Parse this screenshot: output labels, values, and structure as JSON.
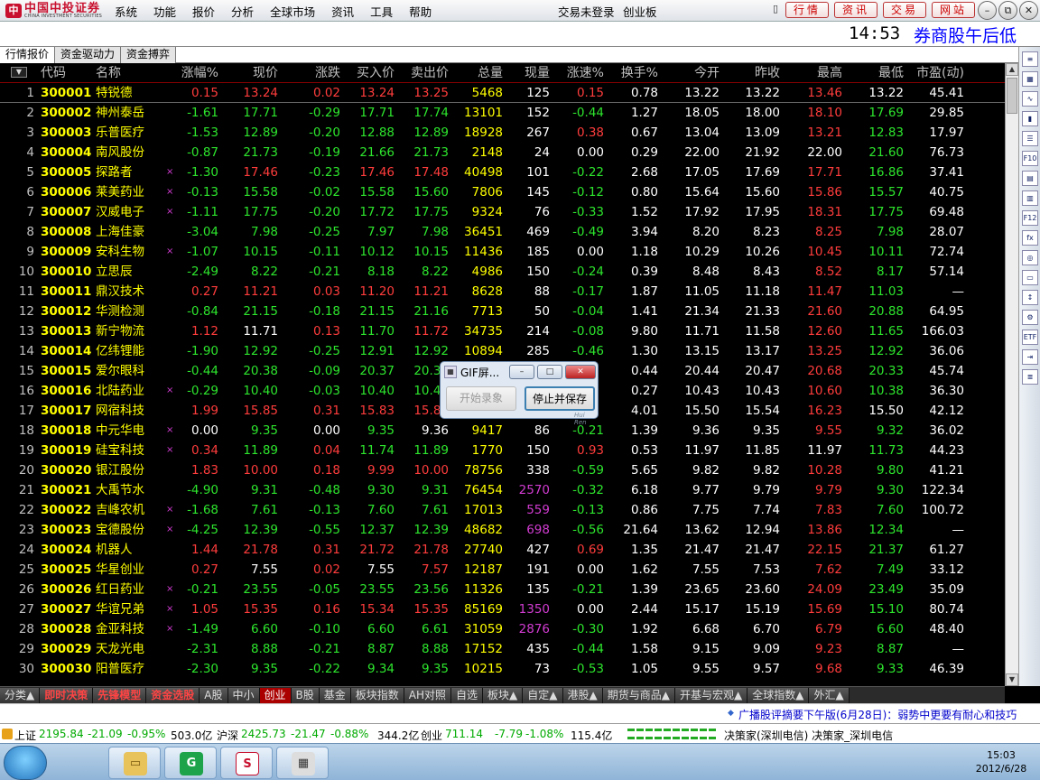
{
  "menubar": {
    "brand_cn": "中国中投证券",
    "brand_en": "CHINA INVESTMENT SECURITIES",
    "menus": [
      "系统",
      "功能",
      "报价",
      "分析",
      "全球市场",
      "资讯",
      "工具",
      "帮助"
    ],
    "trade_status": "交易未登录",
    "board": "创业板",
    "buttons": [
      "行情",
      "资讯",
      "交易",
      "网站"
    ]
  },
  "status": {
    "time": "14:53",
    "session": "券商股午后低"
  },
  "tabs": [
    "行情报价",
    "资金驱动力",
    "资金搏弈"
  ],
  "columns": [
    "代码",
    "名称",
    "涨幅%",
    "现价",
    "涨跌",
    "买入价",
    "卖出价",
    "总量",
    "现量",
    "涨速%",
    "换手%",
    "今开",
    "昨收",
    "最高",
    "最低",
    "市盈(动)"
  ],
  "rows": [
    [
      "1",
      "300001",
      "特锐德",
      "",
      "0.15",
      "13.24",
      "0.02",
      "13.24",
      "13.25",
      "5468",
      "125",
      "0.15",
      "0.78",
      "13.22",
      "13.22",
      "13.46",
      "13.22",
      "45.41"
    ],
    [
      "2",
      "300002",
      "神州泰岳",
      "",
      "-1.61",
      "17.71",
      "-0.29",
      "17.71",
      "17.74",
      "13101",
      "152",
      "-0.44",
      "1.27",
      "18.05",
      "18.00",
      "18.10",
      "17.69",
      "29.85"
    ],
    [
      "3",
      "300003",
      "乐普医疗",
      "",
      "-1.53",
      "12.89",
      "-0.20",
      "12.88",
      "12.89",
      "18928",
      "267",
      "0.38",
      "0.67",
      "13.04",
      "13.09",
      "13.21",
      "12.83",
      "17.97"
    ],
    [
      "4",
      "300004",
      "南风股份",
      "",
      "-0.87",
      "21.73",
      "-0.19",
      "21.66",
      "21.73",
      "2148",
      "24",
      "0.00",
      "0.29",
      "22.00",
      "21.92",
      "22.00",
      "21.60",
      "76.73"
    ],
    [
      "5",
      "300005",
      "探路者",
      "×",
      "-1.30",
      "17.46",
      "-0.23",
      "17.46",
      "17.48",
      "40498",
      "101",
      "-0.22",
      "2.68",
      "17.05",
      "17.69",
      "17.71",
      "16.86",
      "37.41"
    ],
    [
      "6",
      "300006",
      "莱美药业",
      "×",
      "-0.13",
      "15.58",
      "-0.02",
      "15.58",
      "15.60",
      "7806",
      "145",
      "-0.12",
      "0.80",
      "15.64",
      "15.60",
      "15.86",
      "15.57",
      "40.75"
    ],
    [
      "7",
      "300007",
      "汉威电子",
      "×",
      "-1.11",
      "17.75",
      "-0.20",
      "17.72",
      "17.75",
      "9324",
      "76",
      "-0.33",
      "1.52",
      "17.92",
      "17.95",
      "18.31",
      "17.75",
      "69.48"
    ],
    [
      "8",
      "300008",
      "上海佳豪",
      "",
      "-3.04",
      "7.98",
      "-0.25",
      "7.97",
      "7.98",
      "36451",
      "469",
      "-0.49",
      "3.94",
      "8.20",
      "8.23",
      "8.25",
      "7.98",
      "28.07"
    ],
    [
      "9",
      "300009",
      "安科生物",
      "×",
      "-1.07",
      "10.15",
      "-0.11",
      "10.12",
      "10.15",
      "11436",
      "185",
      "0.00",
      "1.18",
      "10.29",
      "10.26",
      "10.45",
      "10.11",
      "72.74"
    ],
    [
      "10",
      "300010",
      "立思辰",
      "",
      "-2.49",
      "8.22",
      "-0.21",
      "8.18",
      "8.22",
      "4986",
      "150",
      "-0.24",
      "0.39",
      "8.48",
      "8.43",
      "8.52",
      "8.17",
      "57.14"
    ],
    [
      "11",
      "300011",
      "鼎汉技术",
      "",
      "0.27",
      "11.21",
      "0.03",
      "11.20",
      "11.21",
      "8628",
      "88",
      "-0.17",
      "1.87",
      "11.05",
      "11.18",
      "11.47",
      "11.03",
      "—"
    ],
    [
      "12",
      "300012",
      "华测检测",
      "",
      "-0.84",
      "21.15",
      "-0.18",
      "21.15",
      "21.16",
      "7713",
      "50",
      "-0.04",
      "1.41",
      "21.34",
      "21.33",
      "21.60",
      "20.88",
      "64.95"
    ],
    [
      "13",
      "300013",
      "新宁物流",
      "",
      "1.12",
      "11.71",
      "0.13",
      "11.70",
      "11.72",
      "34735",
      "214",
      "-0.08",
      "9.80",
      "11.71",
      "11.58",
      "12.60",
      "11.65",
      "166.03"
    ],
    [
      "14",
      "300014",
      "亿纬锂能",
      "",
      "-1.90",
      "12.92",
      "-0.25",
      "12.91",
      "12.92",
      "10894",
      "285",
      "-0.46",
      "1.30",
      "13.15",
      "13.17",
      "13.25",
      "12.92",
      "36.06"
    ],
    [
      "15",
      "300015",
      "爱尔眼科",
      "",
      "-0.44",
      "20.38",
      "-0.09",
      "20.37",
      "20.38",
      "",
      "",
      "",
      "0.44",
      "20.44",
      "20.47",
      "20.68",
      "20.33",
      "45.74"
    ],
    [
      "16",
      "300016",
      "北陆药业",
      "×",
      "-0.29",
      "10.40",
      "-0.03",
      "10.40",
      "10.41",
      "",
      "",
      "",
      "0.27",
      "10.43",
      "10.43",
      "10.60",
      "10.38",
      "36.30"
    ],
    [
      "17",
      "300017",
      "网宿科技",
      "",
      "1.99",
      "15.85",
      "0.31",
      "15.83",
      "15.85",
      "",
      "",
      "",
      "4.01",
      "15.50",
      "15.54",
      "16.23",
      "15.50",
      "42.12"
    ],
    [
      "18",
      "300018",
      "中元华电",
      "×",
      "0.00",
      "9.35",
      "0.00",
      "9.35",
      "9.36",
      "9417",
      "86",
      "-0.21",
      "1.39",
      "9.36",
      "9.35",
      "9.55",
      "9.32",
      "36.02"
    ],
    [
      "19",
      "300019",
      "硅宝科技",
      "×",
      "0.34",
      "11.89",
      "0.04",
      "11.74",
      "11.89",
      "1770",
      "150",
      "0.93",
      "0.53",
      "11.97",
      "11.85",
      "11.97",
      "11.73",
      "44.23"
    ],
    [
      "20",
      "300020",
      "银江股份",
      "",
      "1.83",
      "10.00",
      "0.18",
      "9.99",
      "10.00",
      "78756",
      "338",
      "-0.59",
      "5.65",
      "9.82",
      "9.82",
      "10.28",
      "9.80",
      "41.21"
    ],
    [
      "21",
      "300021",
      "大禹节水",
      "",
      "-4.90",
      "9.31",
      "-0.48",
      "9.30",
      "9.31",
      "76454",
      "2570",
      "-0.32",
      "6.18",
      "9.77",
      "9.79",
      "9.79",
      "9.30",
      "122.34"
    ],
    [
      "22",
      "300022",
      "吉峰农机",
      "×",
      "-1.68",
      "7.61",
      "-0.13",
      "7.60",
      "7.61",
      "17013",
      "559",
      "-0.13",
      "0.86",
      "7.75",
      "7.74",
      "7.83",
      "7.60",
      "100.72"
    ],
    [
      "23",
      "300023",
      "宝德股份",
      "×",
      "-4.25",
      "12.39",
      "-0.55",
      "12.37",
      "12.39",
      "48682",
      "698",
      "-0.56",
      "21.64",
      "13.62",
      "12.94",
      "13.86",
      "12.34",
      "—"
    ],
    [
      "24",
      "300024",
      "机器人",
      "",
      "1.44",
      "21.78",
      "0.31",
      "21.72",
      "21.78",
      "27740",
      "427",
      "0.69",
      "1.35",
      "21.47",
      "21.47",
      "22.15",
      "21.37",
      "61.27"
    ],
    [
      "25",
      "300025",
      "华星创业",
      "",
      "0.27",
      "7.55",
      "0.02",
      "7.55",
      "7.57",
      "12187",
      "191",
      "0.00",
      "1.62",
      "7.55",
      "7.53",
      "7.62",
      "7.49",
      "33.12"
    ],
    [
      "26",
      "300026",
      "红日药业",
      "×",
      "-0.21",
      "23.55",
      "-0.05",
      "23.55",
      "23.56",
      "11326",
      "135",
      "-0.21",
      "1.39",
      "23.65",
      "23.60",
      "24.09",
      "23.49",
      "35.09"
    ],
    [
      "27",
      "300027",
      "华谊兄弟",
      "×",
      "1.05",
      "15.35",
      "0.16",
      "15.34",
      "15.35",
      "85169",
      "1350",
      "0.00",
      "2.44",
      "15.17",
      "15.19",
      "15.69",
      "15.10",
      "80.74"
    ],
    [
      "28",
      "300028",
      "金亚科技",
      "×",
      "-1.49",
      "6.60",
      "-0.10",
      "6.60",
      "6.61",
      "31059",
      "2876",
      "-0.30",
      "1.92",
      "6.68",
      "6.70",
      "6.79",
      "6.60",
      "48.40"
    ],
    [
      "29",
      "300029",
      "天龙光电",
      "",
      "-2.31",
      "8.88",
      "-0.21",
      "8.87",
      "8.88",
      "17152",
      "435",
      "-0.44",
      "1.58",
      "9.15",
      "9.09",
      "9.23",
      "8.87",
      "—"
    ],
    [
      "30",
      "300030",
      "阳普医疗",
      "",
      "-2.30",
      "9.35",
      "-0.22",
      "9.34",
      "9.35",
      "10215",
      "73",
      "-0.53",
      "1.05",
      "9.55",
      "9.57",
      "9.68",
      "9.33",
      "46.39"
    ]
  ],
  "categories": [
    "分类▲",
    "即时决策",
    "先锋模型",
    "资金选股",
    "A股",
    "中小",
    "创业",
    "B股",
    "基金",
    "板块指数",
    "AH对照",
    "自选",
    "板块▲",
    "自定▲",
    "港股▲",
    "期货与商品▲",
    "开基与宏观▲",
    "全球指数▲",
    "外汇▲"
  ],
  "news": "广播股评摘要下午版(6月28日)：弱势中更要有耐心和技巧",
  "indices": {
    "sh_name": "上证",
    "sh_val": "2195.84",
    "sh_chg": "-21.09",
    "sh_pct": "-0.95%",
    "sh_amt": "503.0亿",
    "sz_name": "沪深",
    "sz_val": "2425.73",
    "sz_chg": "-21.47",
    "sz_pct": "-0.88%",
    "sz_amt": "344.2亿",
    "cy_name": "创业",
    "cy_val": "711.14",
    "cy_chg": "-7.79",
    "cy_pct": "-1.08%",
    "cy_amt": "115.4亿",
    "server": "决策家(深圳电信) 决策家_深圳电信"
  },
  "dialog": {
    "title": "GIF屏...",
    "rec": "开始录象",
    "stop": "停止并保存",
    "brand": "Hui Ren"
  },
  "taskbar": {
    "time": "15:03",
    "date": "2012/6/28"
  },
  "colors": {
    "up": "#ff3c3c",
    "down": "#2de52d",
    "code": "#ffff00",
    "bg": "#000000"
  }
}
